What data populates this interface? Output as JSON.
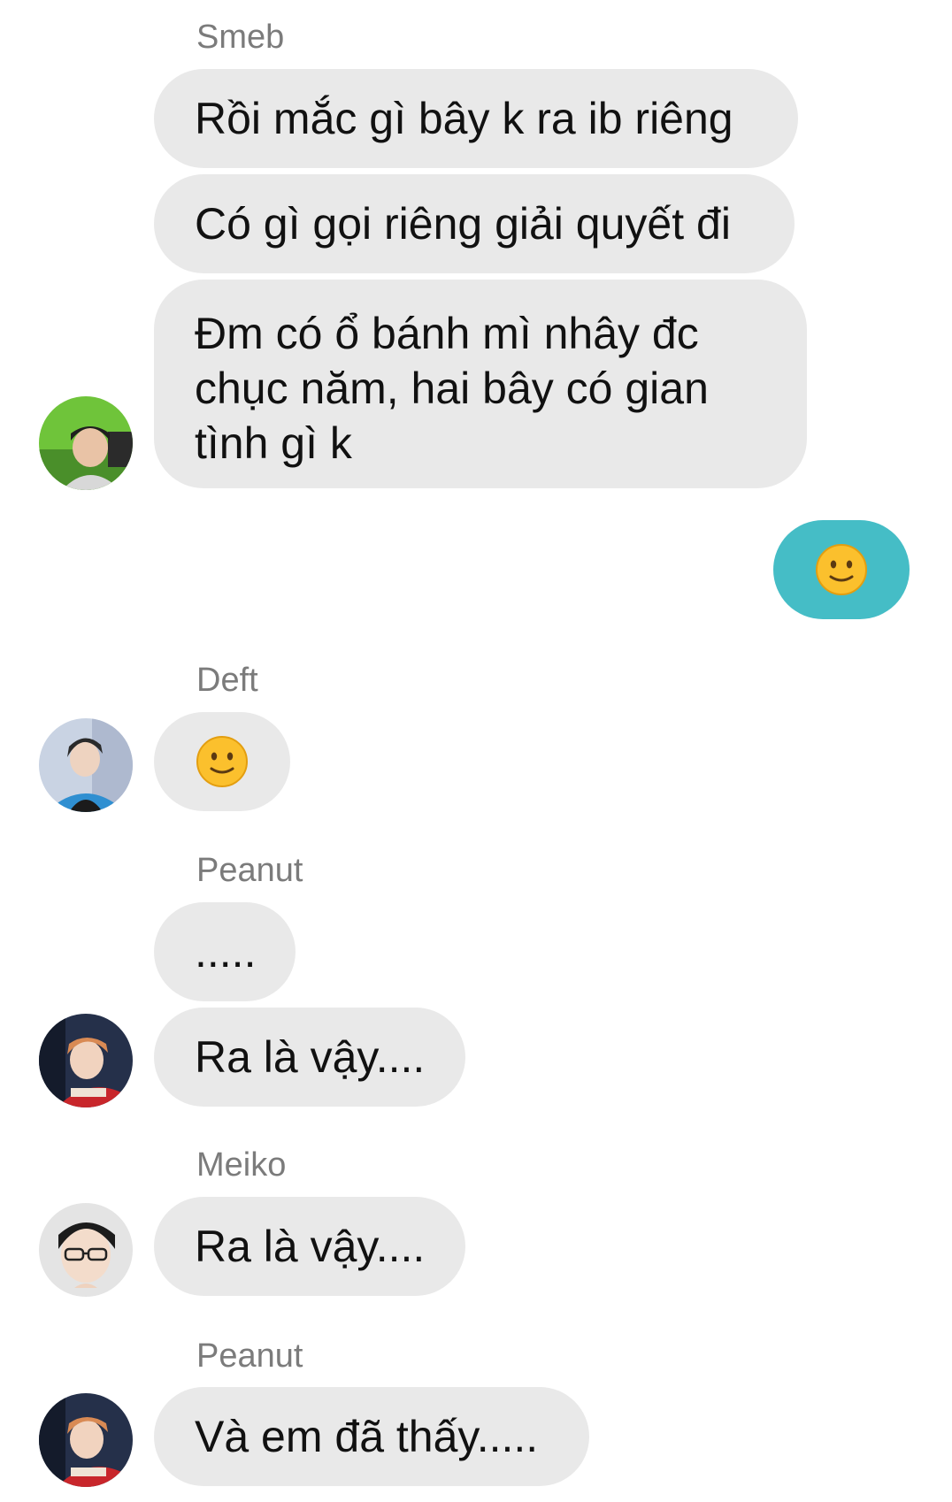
{
  "messages": [
    {
      "sender": "Smeb",
      "lines": [
        "Rồi mắc gì bây k ra ib riêng",
        "Có gì gọi riêng giải quyết đi",
        "Đm có ổ bánh mì nhây đc chục năm, hai bây có gian tình gì k"
      ]
    },
    {
      "outgoing": "slightly-smiling-face-emoji"
    },
    {
      "sender": "Deft",
      "lines": [
        "slightly-smiling-face-emoji"
      ]
    },
    {
      "sender": "Peanut",
      "lines": [
        ".....",
        "Ra là vậy...."
      ]
    },
    {
      "sender": "Meiko",
      "lines": [
        "Ra là vậy...."
      ]
    },
    {
      "sender": "Peanut",
      "lines": [
        "Và em đã thấy....."
      ]
    }
  ],
  "colors": {
    "incoming_bubble": "#e9e9e9",
    "outgoing_bubble": "#45bdc6",
    "sender_name": "#7b7b7b",
    "message_text": "#111111"
  }
}
